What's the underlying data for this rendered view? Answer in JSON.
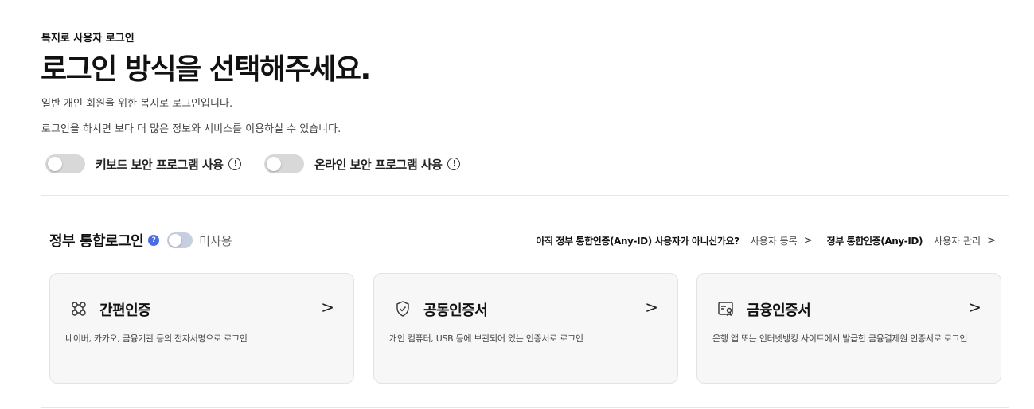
{
  "header": {
    "eyebrow": "복지로 사용자 로그인",
    "title": "로그인 방식을 선택해주세요.",
    "description_line1": "일반 개인 회원을 위한 복지로 로그인입니다.",
    "description_line2": "로그인을 하시면 보다 더 많은 정보와 서비스를 이용하실 수 있습니다."
  },
  "security_toggles": [
    {
      "label": "키보드 보안 프로그램 사용",
      "info": "!",
      "on": false
    },
    {
      "label": "온라인 보안 프로그램 사용",
      "info": "!",
      "on": false
    }
  ],
  "gov_login": {
    "title": "정부 통합로그인",
    "help": "?",
    "status": "미사용",
    "question": "아직 정부 통합인증(Any-ID) 사용자가 아니신가요?",
    "register_link": "사용자 등록",
    "any_id_label": "정부 통합인증(Any-ID)",
    "manage_link": "사용자 관리",
    "chevron": ">"
  },
  "cards": [
    {
      "icon": "simple-auth-icon",
      "title": "간편인증",
      "arrow": ">",
      "description": "네이버, 카카오, 금융기관 등의 전자서명으로 로그인"
    },
    {
      "icon": "shield-check-icon",
      "title": "공동인증서",
      "arrow": ">",
      "description": "개인 컴퓨터, USB 등에 보관되어 있는 인증서로 로그인"
    },
    {
      "icon": "certificate-icon",
      "title": "금융인증서",
      "arrow": ">",
      "description": "은행 앱 또는 인터넷뱅킹 사이트에서 발급한 금융결제원 인증서로 로그인"
    }
  ],
  "colors": {
    "accent": "#4a6ee0",
    "card_bg": "#f7f7f7",
    "toggle_off": "#d8d8d8"
  }
}
